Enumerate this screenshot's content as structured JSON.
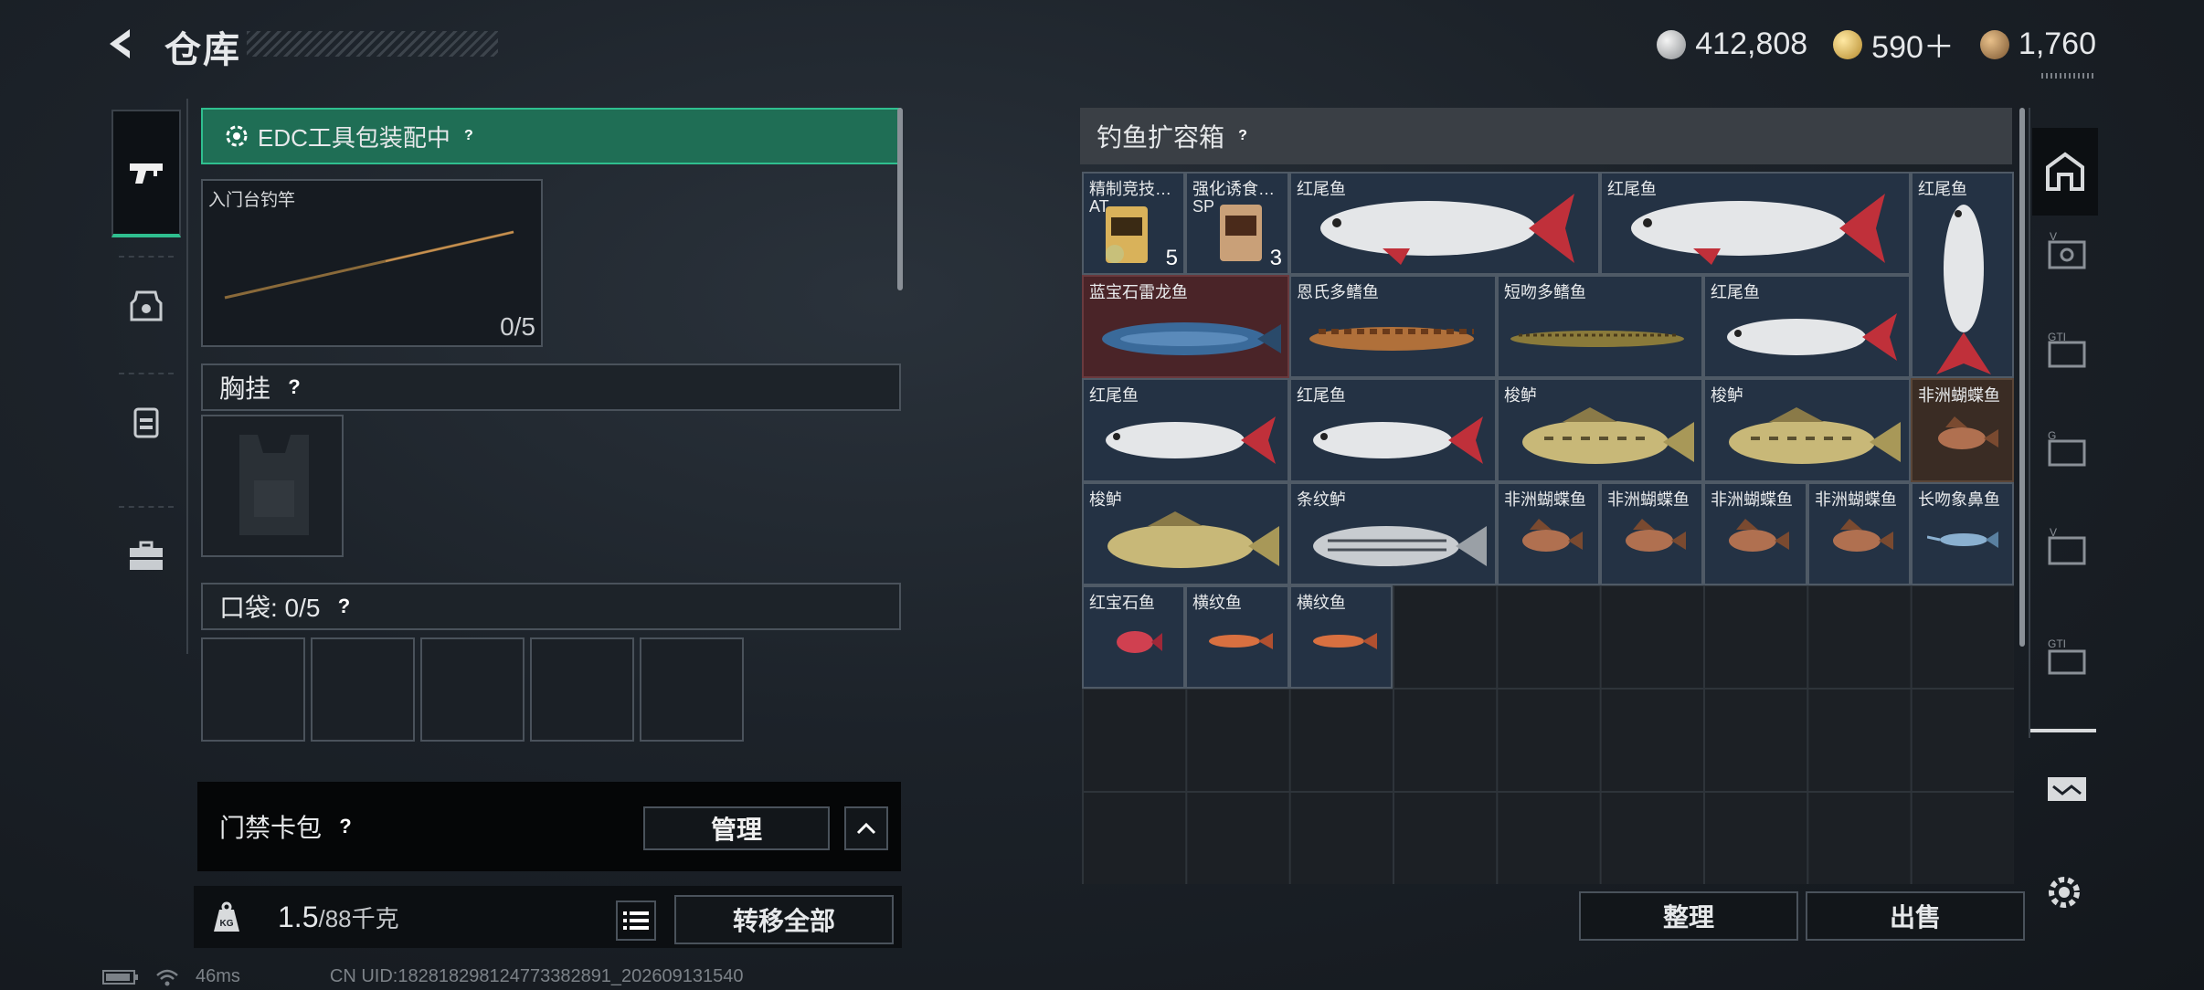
{
  "header": {
    "title": "仓库"
  },
  "currencies": [
    {
      "icon": "silver-coin-icon",
      "value": "412,808"
    },
    {
      "icon": "gold-triangle-coin-icon",
      "value": "590＋"
    },
    {
      "icon": "bronze-coin-icon",
      "value": "1,760"
    }
  ],
  "left": {
    "edc_status": "EDC工具包装配中",
    "rod": {
      "name": "入门台钓竿",
      "count": "0/5"
    },
    "vest_label": "胸挂",
    "pocket_label": "口袋: 0/5",
    "card_pack_label": "门禁卡包",
    "manage_label": "管理",
    "weight_value": "1.5",
    "weight_unit": "/88千克",
    "transfer_label": "转移全部"
  },
  "right": {
    "box_title": "钓鱼扩容箱",
    "sort_label": "整理",
    "sell_label": "出售",
    "items": [
      {
        "name": "精制竞技…",
        "sub": "AT",
        "qty": "5"
      },
      {
        "name": "强化诱食…",
        "sub": "SP",
        "qty": "3"
      },
      {
        "name": "红尾鱼"
      },
      {
        "name": "红尾鱼"
      },
      {
        "name": "红尾鱼"
      },
      {
        "name": "蓝宝石雷龙鱼"
      },
      {
        "name": "恩氏多鳍鱼"
      },
      {
        "name": "短吻多鳍鱼"
      },
      {
        "name": "红尾鱼"
      },
      {
        "name": "红尾鱼"
      },
      {
        "name": "红尾鱼"
      },
      {
        "name": "梭鲈"
      },
      {
        "name": "梭鲈"
      },
      {
        "name": "非洲蝴蝶鱼"
      },
      {
        "name": "梭鲈"
      },
      {
        "name": "条纹鲈"
      },
      {
        "name": "非洲蝴蝶鱼"
      },
      {
        "name": "非洲蝴蝶鱼"
      },
      {
        "name": "非洲蝴蝶鱼"
      },
      {
        "name": "非洲蝴蝶鱼"
      },
      {
        "name": "长吻象鼻鱼"
      },
      {
        "name": "红宝石鱼"
      },
      {
        "name": "横纹鱼"
      },
      {
        "name": "横纹鱼"
      }
    ]
  },
  "status": {
    "ping": "46ms",
    "uid": "CN UID:182818298124773382891_202609131540"
  },
  "colors": {
    "accent_green": "#2fbf8f",
    "edc_bg": "#1f6e55"
  }
}
